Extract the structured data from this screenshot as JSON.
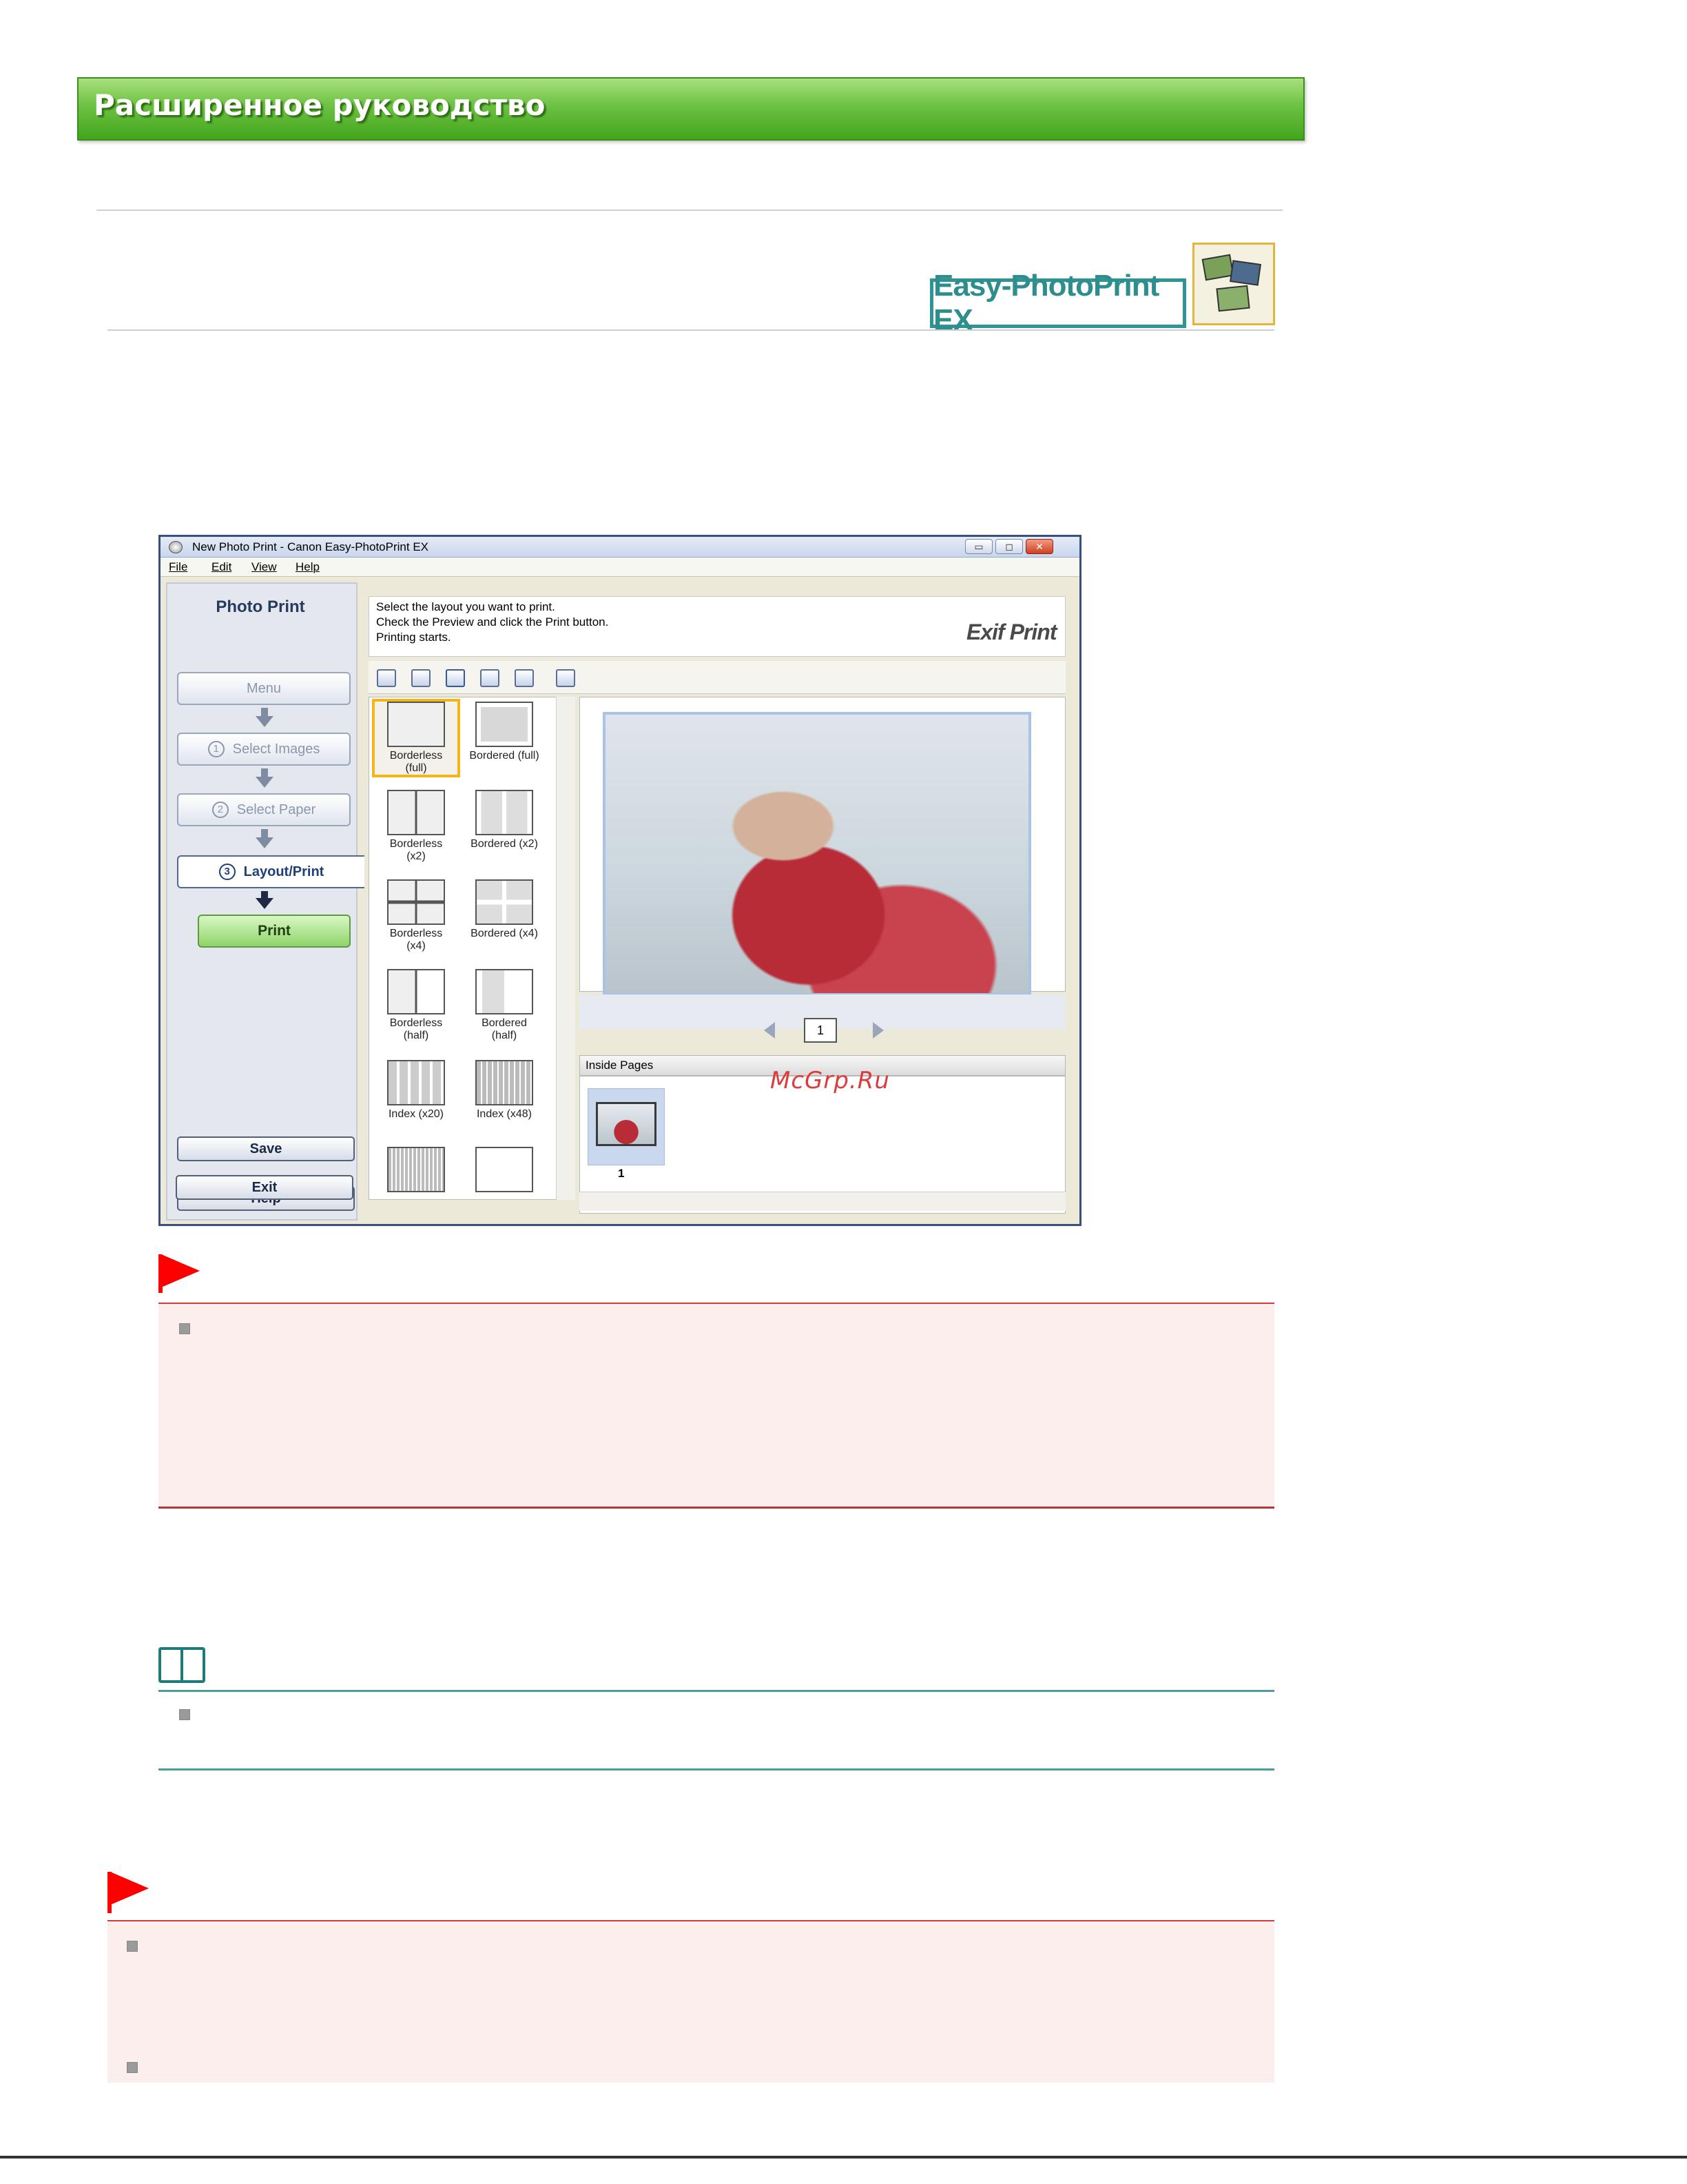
{
  "banner": {
    "title": "Расширенное руководство"
  },
  "product_logo": {
    "name": "Easy-PhotoPrint EX"
  },
  "window": {
    "title": "New Photo Print - Canon Easy-PhotoPrint EX",
    "controls": {
      "minimize": "▭",
      "maximize": "◻",
      "close": "✕"
    },
    "menu": [
      "File",
      "Edit",
      "View",
      "Help"
    ],
    "left_pane": {
      "title": "Photo Print",
      "steps": [
        {
          "label": "Menu",
          "number": ""
        },
        {
          "label": "Select Images",
          "number": "1"
        },
        {
          "label": "Select Paper",
          "number": "2"
        },
        {
          "label": "Layout/Print",
          "number": "3"
        }
      ],
      "print_label": "Print",
      "save_label": "Save",
      "help_label": "Help",
      "exit_label": "Exit"
    },
    "instructions": [
      "Select the layout you want to print.",
      "Check the Preview and click the Print button.",
      "Printing starts."
    ],
    "exif_logo": "Exif Print",
    "toolbar_icons": [
      "rotate-left-icon",
      "rotate-right-icon",
      "trim-icon",
      "date-icon",
      "correct-image-icon",
      "print-settings-icon"
    ],
    "layouts": [
      [
        "Borderless",
        "(full)"
      ],
      [
        "Bordered (full)"
      ],
      [
        "Borderless",
        "(x2)"
      ],
      [
        "Bordered (x2)"
      ],
      [
        "Borderless",
        "(x4)"
      ],
      [
        "Bordered (x4)"
      ],
      [
        "Borderless",
        "(half)"
      ],
      [
        "Bordered",
        "(half)"
      ],
      [
        "Index (x20)"
      ],
      [
        "Index (x48)"
      ]
    ],
    "selected_layout": "Borderless (full)",
    "page_number": "1",
    "inside_pages_label": "Inside Pages",
    "inside_page_number": "1"
  },
  "watermark": "McGrp.Ru",
  "colors": {
    "banner_green": "#6cc142",
    "important_red": "#ff0000",
    "note_teal": "#1f7a7a"
  }
}
